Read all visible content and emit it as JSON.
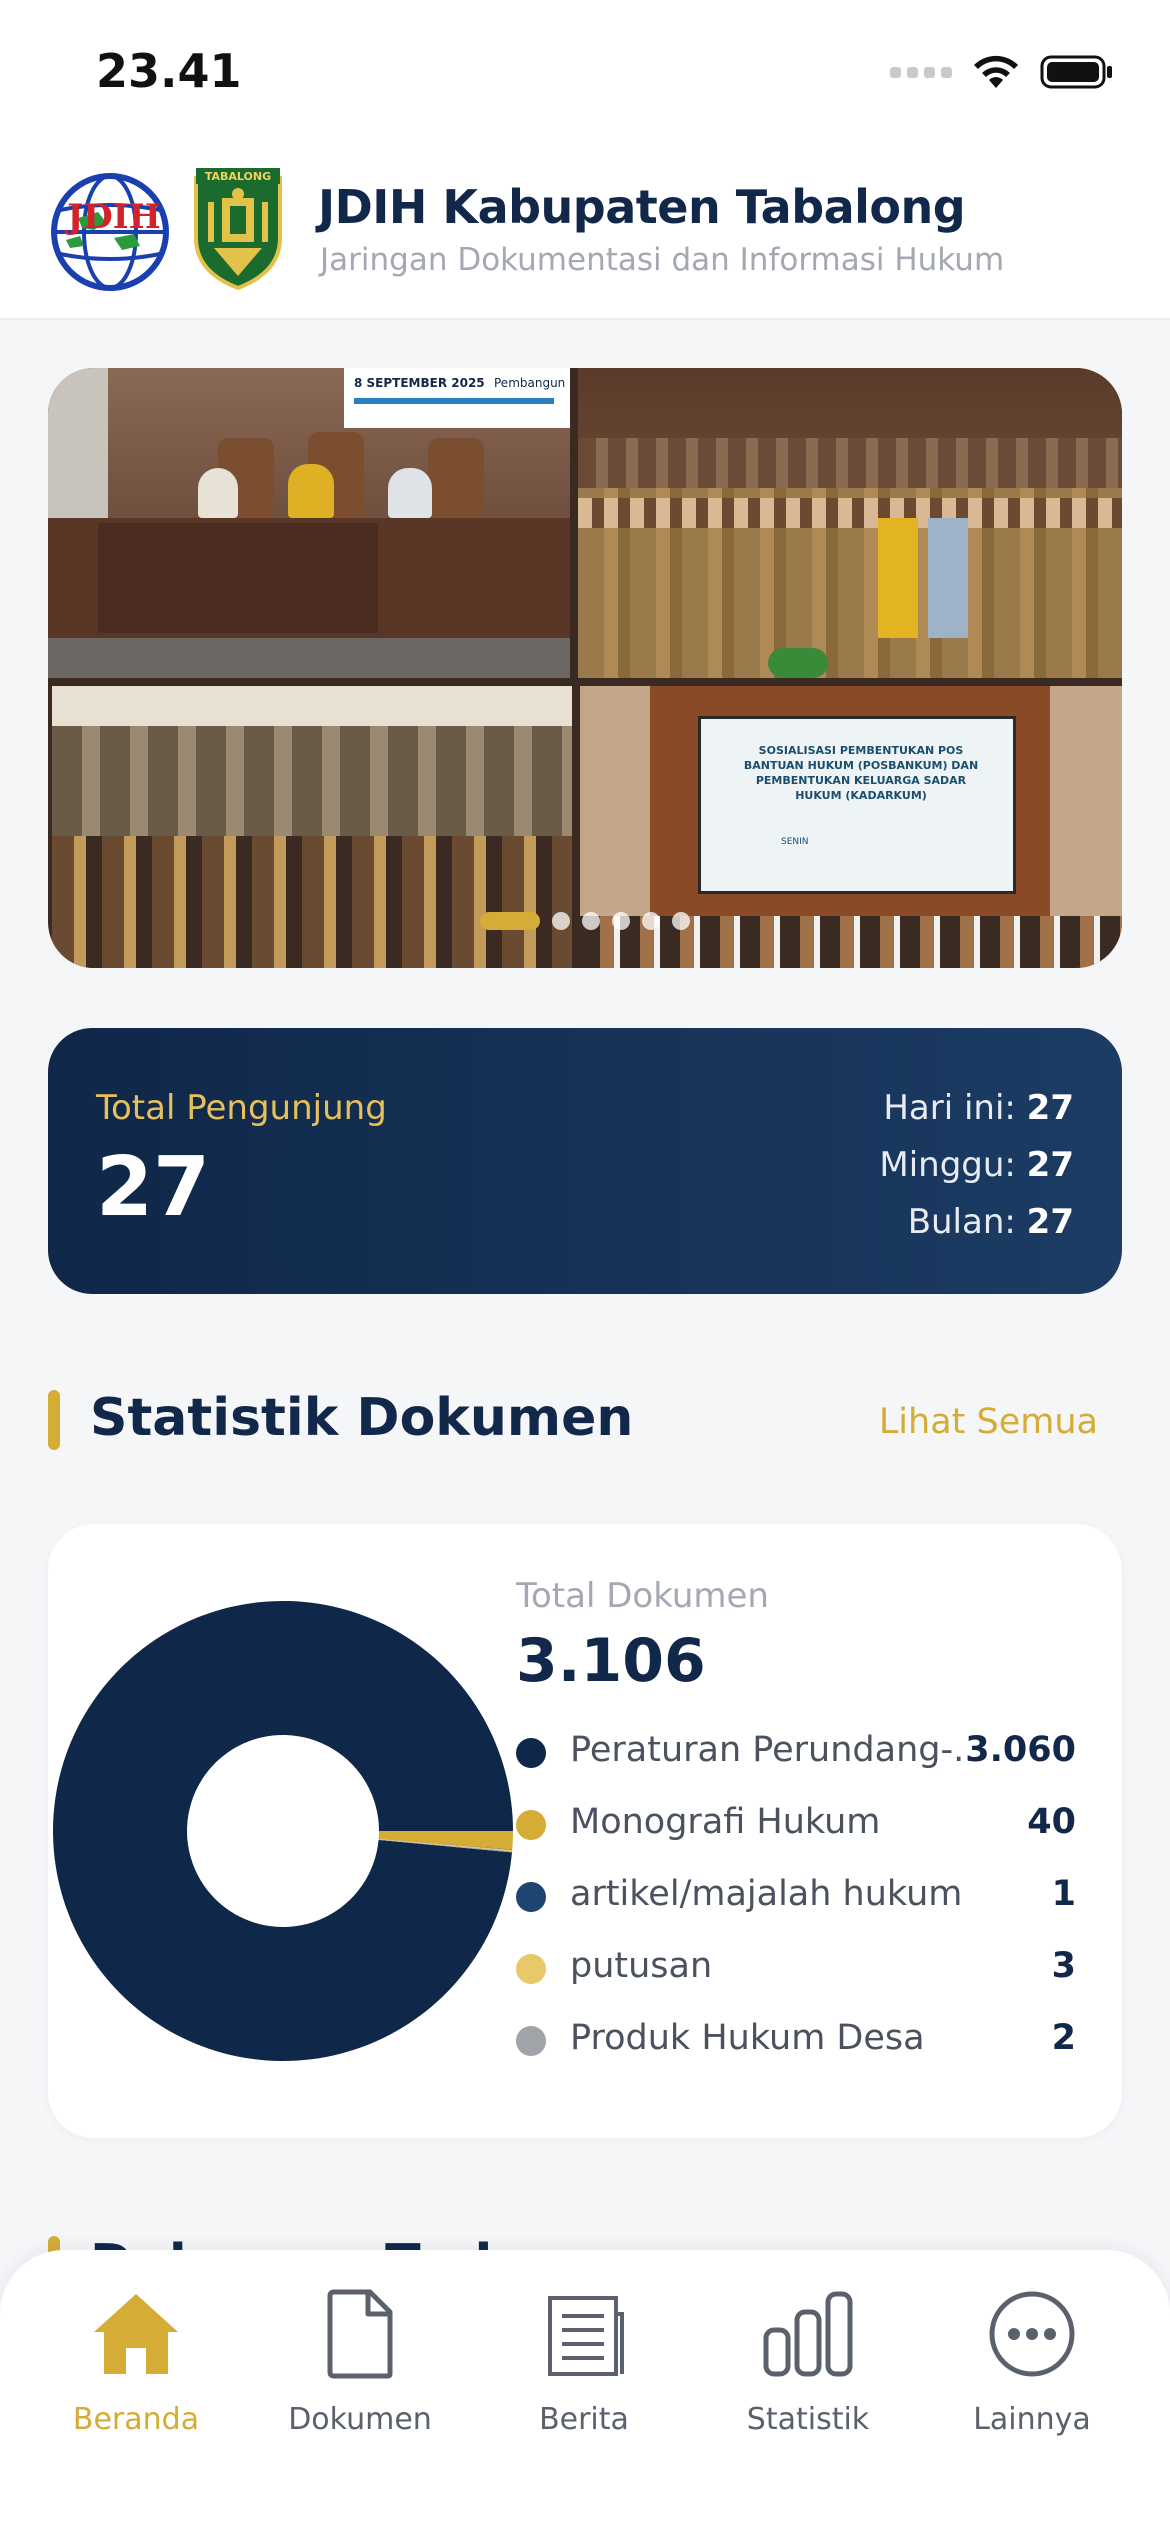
{
  "status_bar": {
    "time": "23.41"
  },
  "header": {
    "title": "JDIH Kabupaten Tabalong",
    "subtitle": "Jaringan Dokumentasi dan Informasi Hukum",
    "logo_jdih_text": "JDIH",
    "logo_tabalong_text": "TABALONG"
  },
  "banner": {
    "slide_count": 6,
    "active_index": 0,
    "poster_date": "8 SEPTEMBER 2025",
    "poster_title": "SOSIALISASI PEMBENTUKAN POS BANTUAN HUKUM (POSBANKUM) DAN PEMBENTUKAN KELUARGA SADAR HUKUM (KADARKUM)",
    "poster_top_text": "Pembangun"
  },
  "visitors": {
    "label": "Total Pengunjung",
    "total": "27",
    "today_label": "Hari ini:",
    "today": "27",
    "week_label": "Minggu:",
    "week": "27",
    "month_label": "Bulan:",
    "month": "27"
  },
  "stats_section": {
    "title": "Statistik Dokumen",
    "see_all": "Lihat Semua",
    "total_label": "Total Dokumen",
    "total": "3.106",
    "items": [
      {
        "name": "Peraturan Perundang-...",
        "count": "3.060",
        "value": 3060,
        "color": "#0f2748"
      },
      {
        "name": "Monografi Hukum",
        "count": "40",
        "value": 40,
        "color": "#d5ac35"
      },
      {
        "name": "artikel/majalah hukum",
        "count": "1",
        "value": 1,
        "color": "#1e4470"
      },
      {
        "name": "putusan",
        "count": "3",
        "value": 3,
        "color": "#e8c96a"
      },
      {
        "name": "Produk Hukum Desa",
        "count": "2",
        "value": 2,
        "color": "#a0a3a8"
      }
    ]
  },
  "next_section": {
    "title": "Dokumen Terbaru"
  },
  "nav": {
    "home": "Beranda",
    "documents": "Dokumen",
    "news": "Berita",
    "stats": "Statistik",
    "more": "Lainnya"
  }
}
